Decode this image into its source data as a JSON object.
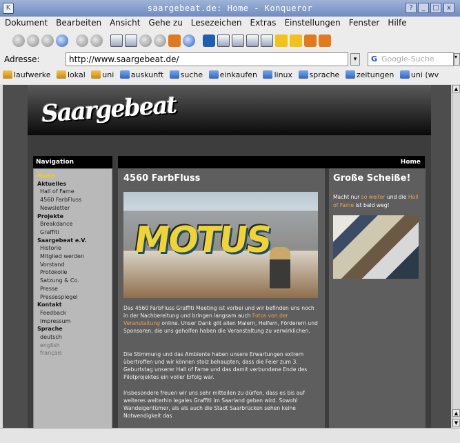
{
  "window": {
    "title": "saargebeat.de: Home - Konqueror",
    "buttons": [
      "?",
      "_",
      "□",
      "x"
    ]
  },
  "menu": [
    "Dokument",
    "Bearbeiten",
    "Ansicht",
    "Gehe zu",
    "Lesezeichen",
    "Extras",
    "Einstellungen",
    "Fenster",
    "Hilfe"
  ],
  "address": {
    "label": "Adresse:",
    "url": "http://www.saargebeat.de/",
    "search_placeholder": "Google-Suche"
  },
  "bookmarks": [
    "laufwerke",
    "lokal",
    "uni",
    "auskunft",
    "suche",
    "einkaufen",
    "linux",
    "sprache",
    "zeitungen",
    "uni (wv"
  ],
  "page": {
    "nav_heading": "Navigation",
    "home_link": "Home",
    "nav": [
      {
        "section": "Aktuelles",
        "items": [
          "Hall of Fame",
          "4560 FarbFluss",
          "Newsletter"
        ]
      },
      {
        "section": "Projekte",
        "items": [
          "Breakdance",
          "Graffiti"
        ]
      },
      {
        "section": "Saargebeat e.V.",
        "items": [
          "Historie",
          "Mitglied werden",
          "Vorstand",
          "Protokolle",
          "Satzung & Co.",
          "Presse",
          "Pressespiegel"
        ]
      },
      {
        "section": "Kontakt",
        "items": [
          "Feedback",
          "Impressum"
        ]
      },
      {
        "section": "Sprache",
        "items": [
          "deutsch",
          "english",
          "français"
        ]
      }
    ],
    "top_right_link": "Home",
    "article_title": "4560 FarbFluss",
    "para1_pre": "Das 4560 FarbFluss Graffiti Meeting ist vorbei und wir befinden uns noch in der Nachbereitung und bringen langsam auch ",
    "para1_link": "Fotos von der Veranstaltung",
    "para1_post": " online. Unser Dank gilt allen Malern, Helfern, Förderern und Sponsoren, die uns geholfen haben die Veranstaltung zu verwirklichen.",
    "para2": "Die Stimmung und das Ambiente haben unsere Erwartungen extrem übertroffen und wir können stolz behaupten, dass die Feier zum 3. Geburtstag unserer Hall of Fame und das damit verbundene Ende des Pilotprojektes ein voller Erfolg war.",
    "para3": "Insbesondere freuen wir uns sehr mitteilen zu dürfen, dass es bis auf weiteres weiterhin legales Graffiti im Saarland geben wird. Sowohl Wandeigentümer, als als auch die Stadt Saarbrücken sehen keine Notwendigkeit das",
    "side_title": "Große Scheiße!",
    "side_pre": "Macht nur ",
    "side_link1": "so weiter",
    "side_mid": " und die ",
    "side_link2": "Hall of Fame",
    "side_post": " ist bald weg!"
  }
}
